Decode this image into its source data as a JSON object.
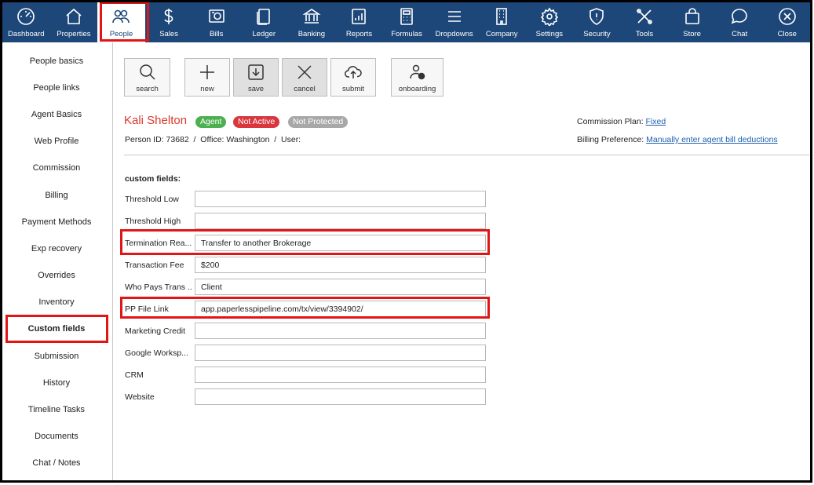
{
  "nav": [
    {
      "label": "Dashboard",
      "icon": "gauge-icon"
    },
    {
      "label": "Properties",
      "icon": "house-icon"
    },
    {
      "label": "People",
      "icon": "people-icon"
    },
    {
      "label": "Sales",
      "icon": "dollar-icon"
    },
    {
      "label": "Bills",
      "icon": "bill-icon"
    },
    {
      "label": "Ledger",
      "icon": "ledger-icon"
    },
    {
      "label": "Banking",
      "icon": "bank-icon"
    },
    {
      "label": "Reports",
      "icon": "report-icon"
    },
    {
      "label": "Formulas",
      "icon": "calculator-icon"
    },
    {
      "label": "Dropdowns",
      "icon": "menu-icon"
    },
    {
      "label": "Company",
      "icon": "building-icon"
    },
    {
      "label": "Settings",
      "icon": "gear-icon"
    },
    {
      "label": "Security",
      "icon": "shield-icon"
    },
    {
      "label": "Tools",
      "icon": "tools-icon"
    },
    {
      "label": "Store",
      "icon": "bag-icon"
    },
    {
      "label": "Chat",
      "icon": "chat-icon"
    },
    {
      "label": "Close",
      "icon": "close-icon"
    }
  ],
  "sidebar": [
    "People basics",
    "People links",
    "Agent Basics",
    "Web Profile",
    "Commission",
    "Billing",
    "Payment Methods",
    "Exp recovery",
    "Overrides",
    "Inventory",
    "Custom fields",
    "Submission",
    "History",
    "Timeline Tasks",
    "Documents",
    "Chat / Notes"
  ],
  "toolbar": {
    "search": "search",
    "new": "new",
    "save": "save",
    "cancel": "cancel",
    "submit": "submit",
    "onboarding": "onboarding"
  },
  "person": {
    "name": "Kali Shelton",
    "badges": {
      "agent": "Agent",
      "active": "Not Active",
      "protected": "Not Protected"
    },
    "id_line": "Person ID: 73682  /  Office: Washington  /  User:",
    "commission_label": "Commission Plan:",
    "commission_value": "Fixed",
    "billing_label": "Billing Preference:",
    "billing_value": "Manually enter agent bill deductions"
  },
  "custom_fields": {
    "title": "custom fields:",
    "fields": [
      {
        "label": "Threshold Low",
        "value": ""
      },
      {
        "label": "Threshold High",
        "value": ""
      },
      {
        "label": "Termination Rea...",
        "value": "Transfer to another Brokerage"
      },
      {
        "label": "Transaction Fee",
        "value": "$200"
      },
      {
        "label": "Who Pays Trans ...",
        "value": "Client"
      },
      {
        "label": "PP File Link",
        "value": "app.paperlesspipeline.com/tx/view/3394902/"
      },
      {
        "label": "Marketing Credit",
        "value": ""
      },
      {
        "label": "Google Worksp...",
        "value": ""
      },
      {
        "label": "CRM",
        "value": ""
      },
      {
        "label": "Website",
        "value": ""
      }
    ]
  },
  "colors": {
    "nav_bg": "#1d4779",
    "highlight": "#e01616",
    "name": "#d83a2e",
    "agent_badge": "#4caf50",
    "active_badge": "#d9363e",
    "protected_badge": "#a8a8a8"
  }
}
